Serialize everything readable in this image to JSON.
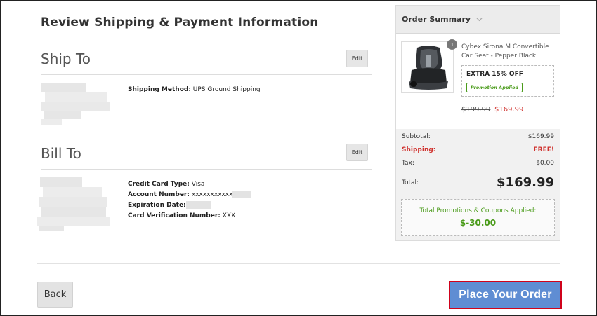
{
  "page": {
    "title": "Review Shipping & Payment Information"
  },
  "ship_to": {
    "title": "Ship To",
    "edit_label": "Edit",
    "method_label": "Shipping Method:",
    "method_value": "UPS Ground Shipping"
  },
  "bill_to": {
    "title": "Bill To",
    "edit_label": "Edit",
    "card_type_label": "Credit Card Type:",
    "card_type_value": "Visa",
    "account_label": "Account Number:",
    "account_value": "xxxxxxxxxxx",
    "expiration_label": "Expiration Date:",
    "cvn_label": "Card Verification Number:",
    "cvn_value": "XXX"
  },
  "summary": {
    "title": "Order Summary",
    "item": {
      "quantity": "1",
      "name": "Cybex Sirona M Convertible Car Seat - Pepper Black",
      "promo_title": "EXTRA 15% OFF",
      "promo_badge": "Promotion Applied",
      "price_old": "$199.99",
      "price_new": "$169.99"
    },
    "subtotal_label": "Subtotal:",
    "subtotal_value": "$169.99",
    "shipping_label": "Shipping:",
    "shipping_value": "FREE!",
    "tax_label": "Tax:",
    "tax_value": "$0.00",
    "total_label": "Total:",
    "total_value": "$169.99",
    "promos_label": "Total Promotions & Coupons Applied:",
    "promos_value": "$-30.00"
  },
  "actions": {
    "back_label": "Back",
    "place_order_label": "Place Your Order"
  },
  "colors": {
    "accent_blue": "#5f8dd3",
    "highlight_red": "#d0021b",
    "promo_green": "#4a9b1a",
    "sale_red": "#d0312d"
  }
}
